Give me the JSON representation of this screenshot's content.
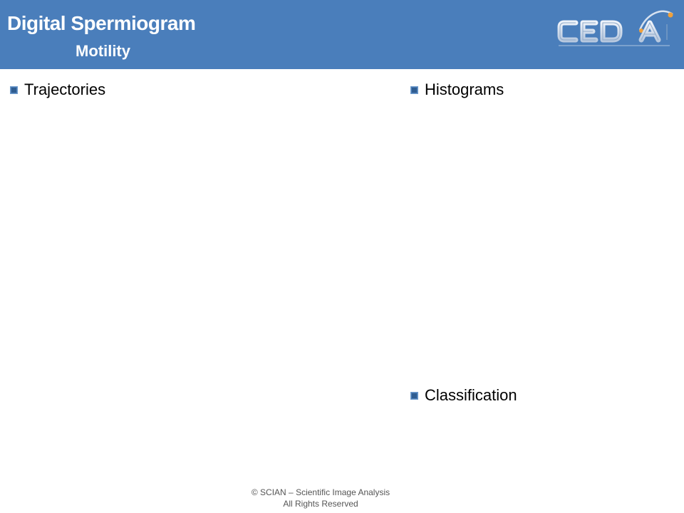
{
  "header": {
    "title": "Digital Spermiogram",
    "subtitle": "Motility",
    "logo": {
      "text": "CEDAI",
      "tagline": "Centro de Espermiogramas Digitales Asistidos por Internet",
      "colors": {
        "letters": "#c9d6e8",
        "accent": "#f0a03a"
      }
    }
  },
  "sections": {
    "trajectories": "Trajectories",
    "histograms": "Histograms",
    "classification": "Classification"
  },
  "footer": {
    "line1": "© SCIAN – Scientific Image Analysis",
    "line2": "All Rights Reserved"
  },
  "colors": {
    "header_bg": "#4a7ebb",
    "bullet": "#2f5d91",
    "text": "#000000",
    "footer_text": "#555555"
  }
}
